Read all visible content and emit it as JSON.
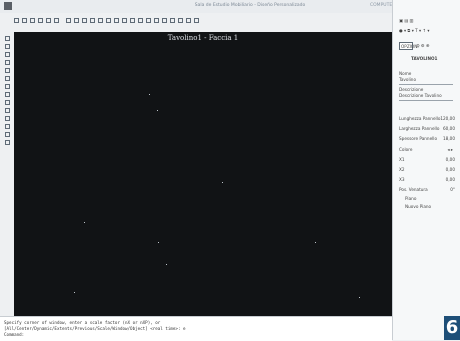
{
  "window": {
    "title": "Sala de Estudio Mobiliario - Diseño Personalizado",
    "status": "COMPUTERSIZE 600"
  },
  "viewport": {
    "title": "Tavolino1 - Faccia 1"
  },
  "right_panel": {
    "tabs": [
      "OPZIONI"
    ],
    "object_name": "TAVOLINO1",
    "fields": [
      {
        "label": "Nome",
        "value": "Tavolino"
      },
      {
        "label": "Descrizione",
        "value": "Descrizione Tavolino"
      },
      {
        "label": "Lunghezza Pannello",
        "value": "120,00"
      },
      {
        "label": "Larghezza Pannello",
        "value": "60,00"
      },
      {
        "label": "Spessore Pannello",
        "value": "18,00"
      },
      {
        "label": "Colore",
        "value": ""
      },
      {
        "label": "X1",
        "value": "0,00"
      },
      {
        "label": "X2",
        "value": "0,00"
      },
      {
        "label": "X3",
        "value": "0,00"
      },
      {
        "label": "Pos. Venatura",
        "value": "0°"
      },
      {
        "label": "Piano",
        "value": ""
      },
      {
        "label": "Nuovo Piano",
        "value": ""
      }
    ]
  },
  "command_line": {
    "lines": [
      "Specify corner of window, enter a scale factor (nX or nXP), or",
      "[All/Center/Dynamic/Extents/Previous/Scale/Window/Object] <real time>: e",
      "Command:"
    ]
  },
  "badge": {
    "text": "6"
  }
}
